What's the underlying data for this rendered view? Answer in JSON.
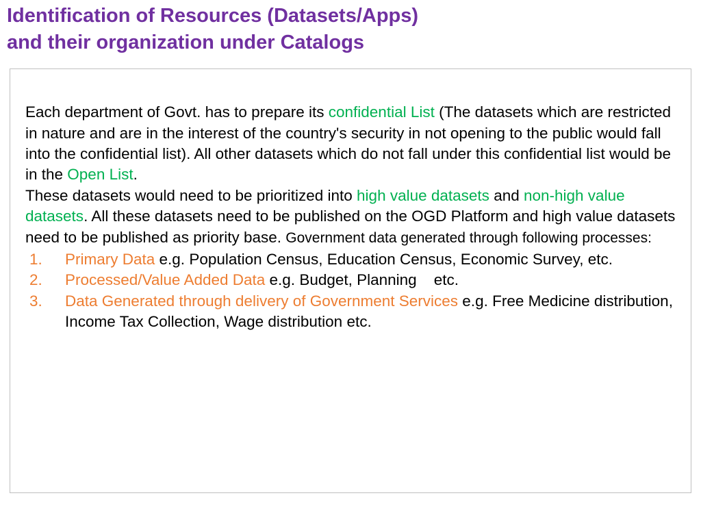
{
  "title": {
    "line1": "Identification of Resources (Datasets/Apps)",
    "line2": "and their organization under Catalogs"
  },
  "body": {
    "p1_pre": "Each department of Govt. has to prepare its ",
    "p1_hl1": "confidential List",
    "p1_mid": " (The datasets which are restricted in nature and are in the interest of the country's security in not opening to the public would fall into the confidential list). All other datasets which do not fall under this confidential list would be in the ",
    "p1_hl2": "Open List",
    "p1_end": ".",
    "p2_pre": "These datasets would need to be prioritized into ",
    "p2_hl1": "high value datasets",
    "p2_mid1": " and ",
    "p2_hl2": "non-high value datasets",
    "p2_mid2": ". All these datasets need to be published on the OGD Platform and high value datasets need to be published as priority base. ",
    "p2_intro": "Government data generated through following processes:"
  },
  "list": [
    {
      "label": "Primary Data",
      "rest": " e.g. Population Census, Education Census, Economic Survey, etc."
    },
    {
      "label": "Processed/Value Added Data",
      "rest": " e.g. Budget, Planning    etc."
    },
    {
      "label": "Data Generated through delivery of Government Services",
      "rest": " e.g. Free Medicine distribution, Income Tax Collection, Wage distribution etc."
    }
  ]
}
